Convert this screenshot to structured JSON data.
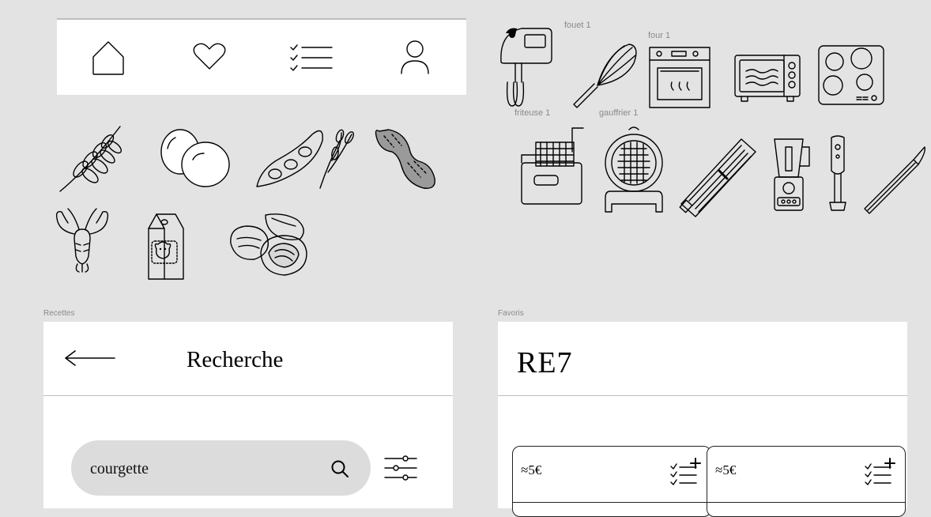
{
  "navbar": {
    "items": [
      {
        "icon": "home-icon"
      },
      {
        "icon": "heart-icon"
      },
      {
        "icon": "checklist-icon"
      },
      {
        "icon": "user-icon"
      }
    ]
  },
  "equipment_labels": {
    "fouet": "fouet 1",
    "four": "four 1",
    "friteuse": "friteuse 1",
    "gauffrier": "gauffrier 1"
  },
  "allergen_icons": [
    "wheat-icon",
    "eggs-icon",
    "soy-icon",
    "peanut-icon",
    "crayfish-icon",
    "milk-carton-icon",
    "walnuts-icon"
  ],
  "equipment_icons": [
    "hand-mixer-icon",
    "whisk-icon",
    "oven-icon",
    "microwave-icon",
    "cooktop-icon",
    "fryer-icon",
    "waffle-iron-icon",
    "mandoline-icon",
    "blender-icon",
    "immersion-blender-icon",
    "peeler-icon"
  ],
  "recettes": {
    "frame_label": "Recettes",
    "title": "Recherche",
    "search": {
      "value": "courgette",
      "placeholder": ""
    }
  },
  "favoris": {
    "frame_label": "Favoris",
    "title": "RE7",
    "cards": [
      {
        "price": "≈5€"
      },
      {
        "price": "≈5€"
      }
    ]
  }
}
